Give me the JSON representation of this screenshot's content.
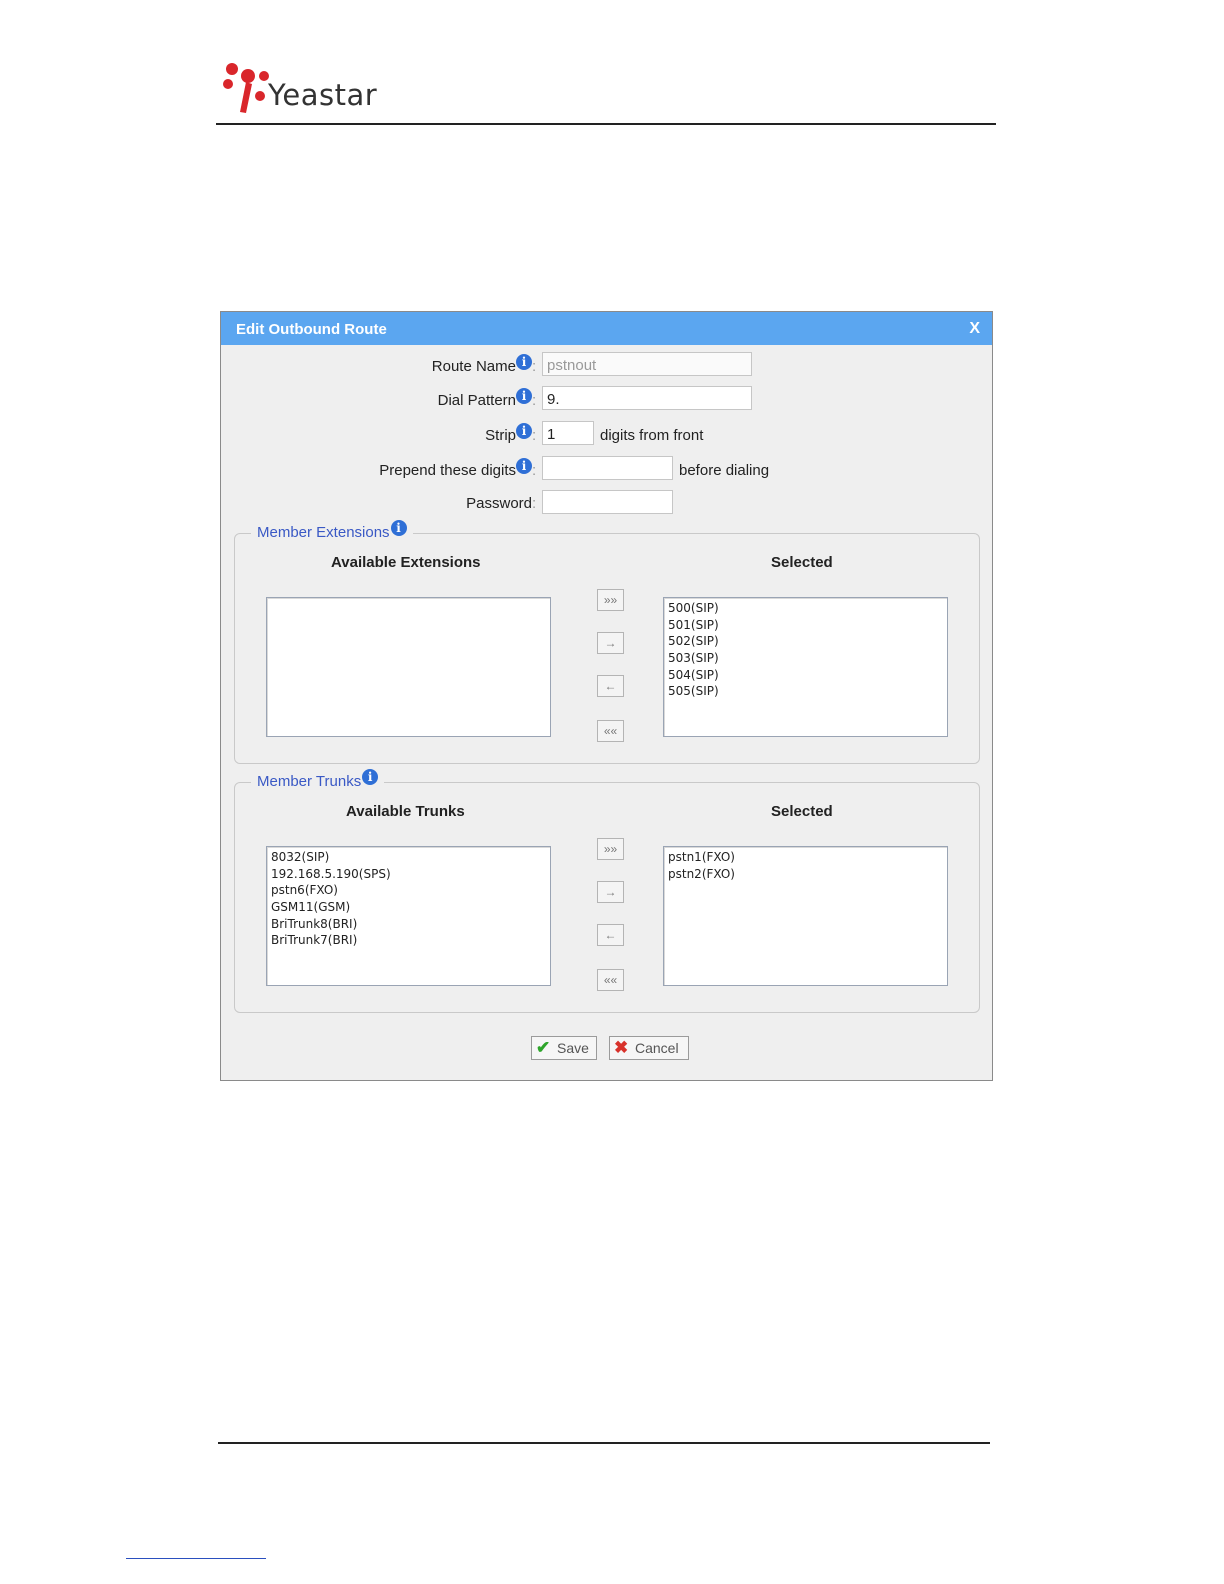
{
  "brand": {
    "name": "Yeastar"
  },
  "dialog": {
    "title": "Edit Outbound Route",
    "close_label": "X",
    "fields": {
      "route_name": {
        "label": "Route Name",
        "value": "pstnout"
      },
      "dial_pattern": {
        "label": "Dial Pattern",
        "value": "9."
      },
      "strip": {
        "label": "Strip",
        "value": "1",
        "suffix": "digits from front"
      },
      "prepend": {
        "label": "Prepend these digits",
        "value": "",
        "suffix": "before dialing"
      },
      "password": {
        "label": "Password",
        "value": ""
      }
    },
    "colon": ":",
    "members_extensions": {
      "legend": "Member Extensions",
      "available_title": "Available Extensions",
      "selected_title": "Selected",
      "available": [],
      "selected": [
        "500(SIP)",
        "501(SIP)",
        "502(SIP)",
        "503(SIP)",
        "504(SIP)",
        "505(SIP)"
      ]
    },
    "members_trunks": {
      "legend": "Member Trunks",
      "available_title": "Available Trunks",
      "selected_title": "Selected",
      "available": [
        "8032(SIP)",
        "192.168.5.190(SPS)",
        "pstn6(FXO)",
        "GSM11(GSM)",
        "BriTrunk8(BRI)",
        "BriTrunk7(BRI)"
      ],
      "selected": [
        "pstn1(FXO)",
        "pstn2(FXO)"
      ]
    },
    "move_buttons": {
      "all_right": "»»",
      "right": "→",
      "left": "←",
      "all_left": "««"
    },
    "info_glyph": "i",
    "save_label": "Save",
    "cancel_label": "Cancel"
  },
  "colors": {
    "header": "#5ba6f0",
    "legend": "#3a59c5",
    "info": "#2f6fd6",
    "save_icon": "#2ea52b",
    "cancel_icon": "#d8322b"
  }
}
